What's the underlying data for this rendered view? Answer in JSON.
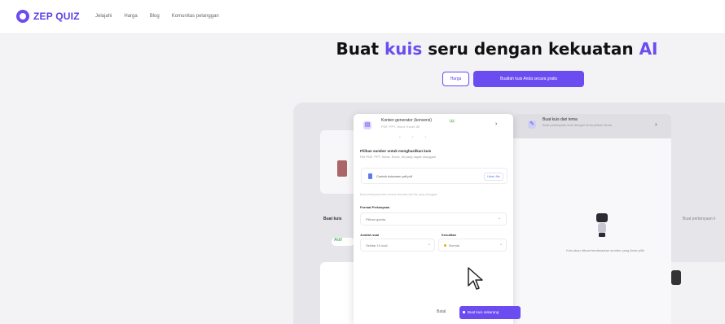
{
  "app": {
    "logo_text": "ZEP QUIZ"
  },
  "nav": {
    "items": [
      "Jelajahi",
      "Harga",
      "Blog",
      "Komunitas pelanggan"
    ]
  },
  "hero": {
    "title_part1": "Buat",
    "title_highlight1": "kuis",
    "title_part2": "seru dengan kekuatan",
    "title_highlight2": "AI"
  },
  "cta": {
    "price_label": "Harga",
    "start_label": "Buatlah kuis Anda secara gratis"
  },
  "modal": {
    "title": "Konten generator (konversi)",
    "badge": "AI",
    "subtitle": "PDF, PPT, Word, Excel, dll",
    "upload_heading": "Pilihan sumber untuk menghasilkan kuis",
    "upload_subheading": "File PDF, PPT, Word, Excel, dll yang dapat diunggah",
    "file_name": "Contoh dokumen pdf.pdf",
    "change_button": "Ubah file",
    "hint": "Buat pertanyaan kuis secara otomatis dari file yang diunggah",
    "label_format": "Format Pertanyaan",
    "format_value": "Pilihan ganda",
    "label_count": "Jumlah soal",
    "count_value": "Sekitar 10 soal",
    "label_difficulty": "Kesulitan",
    "difficulty_value": "Normal",
    "cancel": "Batal",
    "create": "Buat kuis sekarang"
  },
  "tab2": {
    "title": "Buat kuis dari tema",
    "subtitle": "Buat pertanyaan kuis dengan tema pilihan Anda"
  },
  "right_panel": {
    "text": "Kuis akan dibuat berdasarkan sumber yang Anda pilih"
  },
  "side": {
    "label": "Buat kuis",
    "pill": "Aktif"
  },
  "icons": {
    "logo": "logo-icon",
    "file": "file-icon",
    "robot": "robot-icon",
    "close": "chevron-right-icon"
  },
  "colors": {
    "accent": "#6a4cf0",
    "success": "#2a9d3a"
  }
}
